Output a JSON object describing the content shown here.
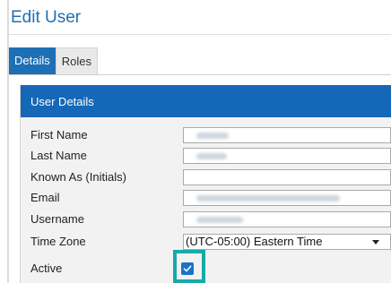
{
  "header": {
    "title": "Edit User"
  },
  "tabs": [
    {
      "label": "Details",
      "active": true
    },
    {
      "label": "Roles",
      "active": false
    }
  ],
  "panel": {
    "title": "User Details"
  },
  "fields": {
    "first_name": {
      "label": "First Name"
    },
    "last_name": {
      "label": "Last Name"
    },
    "known_as": {
      "label": "Known As (Initials)"
    },
    "email": {
      "label": "Email"
    },
    "username": {
      "label": "Username"
    },
    "time_zone": {
      "label": "Time Zone",
      "value": "(UTC-05:00) Eastern Time"
    },
    "active": {
      "label": "Active",
      "checked": true
    }
  },
  "colors": {
    "accent": "#1f6fb5",
    "panel_header": "#1567b8",
    "highlight": "#16aaa8",
    "checkbox": "#1a73c9"
  },
  "icons": {
    "time_zone_arrow": "chevron-down-icon",
    "active_check": "checkmark-icon"
  }
}
